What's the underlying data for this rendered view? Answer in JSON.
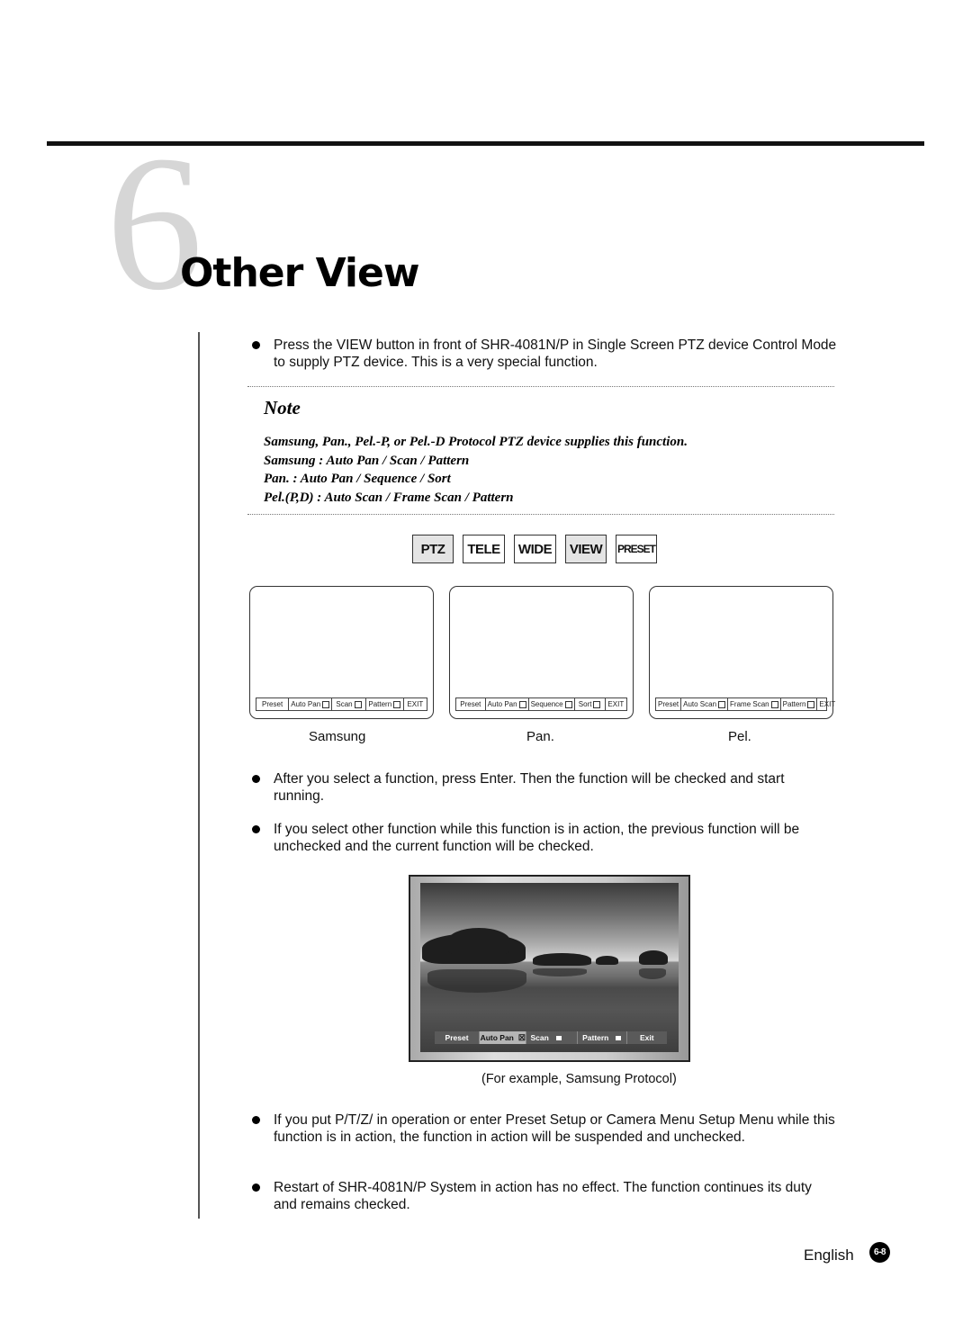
{
  "chapter": {
    "number": "6",
    "title": "Other View"
  },
  "intro_bullet": "Press the VIEW button in front of SHR-4081N/P in Single Screen PTZ device Control Mode to supply PTZ device. This is a very special function.",
  "note": {
    "heading": "Note",
    "lines": [
      "Samsung, Pan., Pel.-P, or Pel.-D Protocol PTZ device supplies this function.",
      "Samsung : Auto Pan  / Scan / Pattern",
      "Pan. : Auto Pan  / Sequence / Sort",
      "Pel.(P,D) : Auto Scan / Frame Scan / Pattern"
    ]
  },
  "keypad": [
    {
      "label": "PTZ",
      "highlighted": true
    },
    {
      "label": "TELE",
      "highlighted": false
    },
    {
      "label": "WIDE",
      "highlighted": false
    },
    {
      "label": "VIEW",
      "highlighted": true
    },
    {
      "label": "PRESET",
      "highlighted": false
    }
  ],
  "screens": [
    {
      "label": "Samsung",
      "menu": [
        {
          "text": "Preset",
          "checkbox": false
        },
        {
          "text": "Auto Pan",
          "checkbox": true
        },
        {
          "text": "Scan",
          "checkbox": true
        },
        {
          "text": "Pattern",
          "checkbox": true
        },
        {
          "text": "EXIT",
          "checkbox": false
        }
      ]
    },
    {
      "label": "Pan.",
      "menu": [
        {
          "text": "Preset",
          "checkbox": false
        },
        {
          "text": "Auto Pan",
          "checkbox": true
        },
        {
          "text": "Sequence",
          "checkbox": true
        },
        {
          "text": "Sort",
          "checkbox": true
        },
        {
          "text": "EXIT",
          "checkbox": false
        }
      ]
    },
    {
      "label": "Pel.",
      "menu": [
        {
          "text": "Preset",
          "checkbox": false
        },
        {
          "text": "Auto Scan",
          "checkbox": true
        },
        {
          "text": "Frame Scan",
          "checkbox": true
        },
        {
          "text": "Pattern",
          "checkbox": true
        },
        {
          "text": "EXIT",
          "checkbox": false
        }
      ]
    }
  ],
  "bullets_mid": [
    "After you select a function, press Enter. Then the function will be checked and start running.",
    "If you select other function while this function is in action, the previous function will be unchecked and the current function will be checked."
  ],
  "example_osd": [
    {
      "text": "Preset",
      "state": "none"
    },
    {
      "text": "Auto Pan",
      "state": "checked"
    },
    {
      "text": "Scan",
      "state": "unchecked"
    },
    {
      "text": "Pattern",
      "state": "unchecked"
    },
    {
      "text": "Exit",
      "state": "none"
    }
  ],
  "example_caption": "(For example, Samsung Protocol)",
  "bullets_end": [
    "If you put P/T/Z/ in operation or enter Preset Setup or Camera Menu Setup Menu while this function is in action, the function in action will be suspended and unchecked.",
    "Restart of SHR-4081N/P System in action has no effect. The function continues its duty and remains checked."
  ],
  "footer": {
    "language": "English",
    "page": "6-8"
  }
}
